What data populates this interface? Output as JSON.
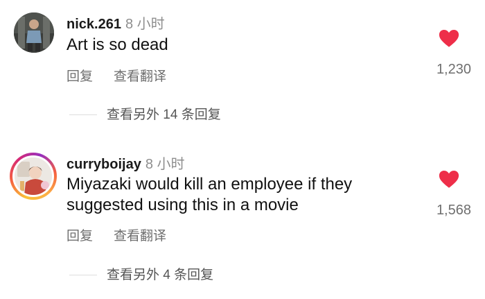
{
  "comments": [
    {
      "username": "nick.261",
      "time": "8 小时",
      "text": "Art is so dead",
      "reply_label": "回复",
      "translate_label": "查看翻译",
      "like_count": "1,230",
      "more_replies": "查看另外 14 条回复"
    },
    {
      "username": "curryboijay",
      "time": "8 小时",
      "text": "Miyazaki would kill an employee if they suggested using this in a movie",
      "reply_label": "回复",
      "translate_label": "查看翻译",
      "like_count": "1,568",
      "more_replies": "查看另外 4 条回复"
    }
  ],
  "colors": {
    "heart": "#ee2e49",
    "muted": "#8e8e8e"
  },
  "icons": {
    "like": "heart-icon"
  }
}
